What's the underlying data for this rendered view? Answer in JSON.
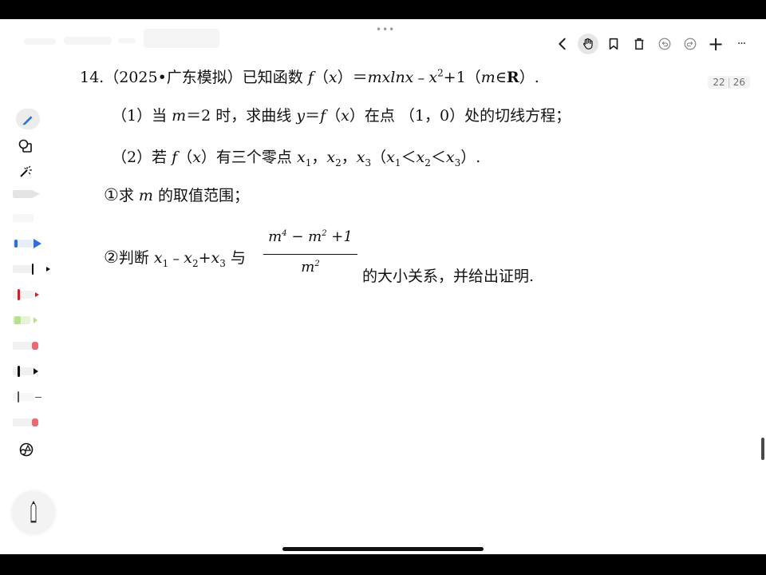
{
  "toolbar": {
    "back_label": "‹",
    "add_label": "+",
    "more_label": "···"
  },
  "page_indicator": {
    "current": "22",
    "total": "26"
  },
  "drag_handle": "•••",
  "problem": {
    "number": "14.",
    "source": "（2025•广东模拟）",
    "stem_text": "已知函数",
    "stem_func": "f（x）＝mxlnx﹣x",
    "stem_tail": "+1（m∈",
    "stem_R": "R",
    "stem_end": "）.",
    "part1_prefix": "（1）当",
    "part1_m": "m",
    "part1_mid": "＝2 时，求曲线",
    "part1_y": "y",
    "part1_eq": "＝",
    "part1_f": "f",
    "part1_tail": "（x）在点 （1，0）处的切线方程；",
    "part2_prefix": "（2）若",
    "part2_f": "f",
    "part2_mid": "（x）有三个零点",
    "part2_roots": "x",
    "part2_order": "（x",
    "sub_i_label": "①",
    "sub_i_text_pre": "求",
    "sub_i_m": "m",
    "sub_i_text_post": "的取值范围；",
    "sub_ii_label": "②",
    "sub_ii_text_pre": "判断",
    "sub_ii_expr": "x",
    "sub_ii_with": "与",
    "fraction_num": "m",
    "fraction_den": "m",
    "sub_ii_text_post": "的大小关系，并给出证明."
  },
  "colors": {
    "pen_blue": "#2f6fd6",
    "marker_red": "#c0282f",
    "marker_pink": "#e86a74",
    "marker_green": "#b9e08f",
    "ink": "#111111"
  }
}
